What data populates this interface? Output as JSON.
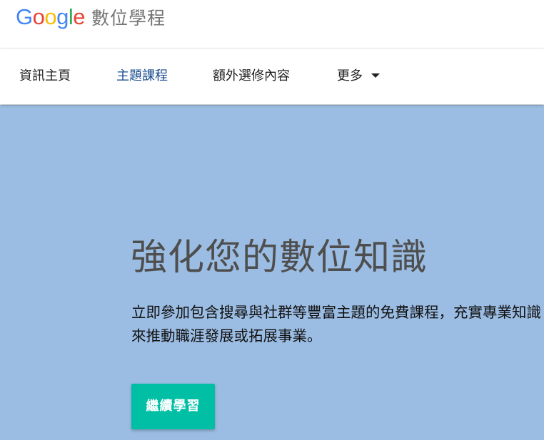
{
  "header": {
    "logo": {
      "letters": [
        {
          "char": "G",
          "color": "#4285F4"
        },
        {
          "char": "o",
          "color": "#EA4335"
        },
        {
          "char": "o",
          "color": "#FBBC05"
        },
        {
          "char": "g",
          "color": "#4285F4"
        },
        {
          "char": "l",
          "color": "#34A853"
        },
        {
          "char": "e",
          "color": "#EA4335"
        }
      ],
      "suffix": "數位學程"
    }
  },
  "nav": {
    "items": [
      {
        "label": "資訊主頁"
      },
      {
        "label": "主題課程"
      },
      {
        "label": "額外選修內容"
      },
      {
        "label": "更多"
      }
    ],
    "more_icon": "caret-down-icon"
  },
  "hero": {
    "title": "強化您的數位知識",
    "description": "立即參加包含搜尋與社群等豐富主題的免費課程，充實專業知識來推動職涯發展或拓展事業。",
    "cta_label": "繼續學習",
    "background_color": "#9cbde3",
    "cta_color": "#00bfa5"
  }
}
